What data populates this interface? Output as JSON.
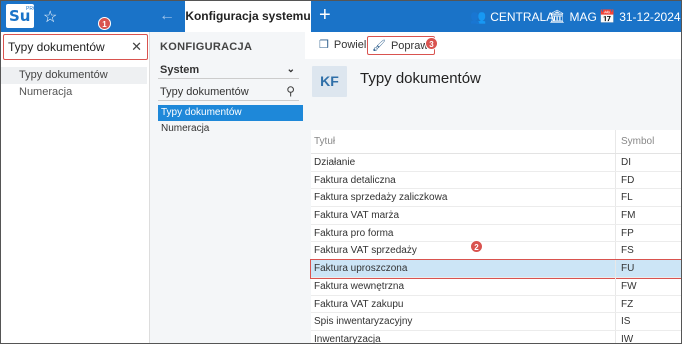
{
  "topbar": {
    "logo_main": "Su",
    "logo_pro": "PRO",
    "active_tab": "Konfiguracja systemu",
    "centrala": "CENTRALA",
    "mag": "MAG",
    "date": "31-12-2024"
  },
  "left": {
    "search_value": "Typy dokumentów",
    "items": [
      "Typy dokumentów",
      "Numeracja"
    ]
  },
  "mid": {
    "title": "KONFIGURACJA",
    "select_value": "System",
    "search_value": "Typy dokumentów",
    "items": [
      "Typy dokumentów",
      "Numeracja"
    ]
  },
  "toolbar": {
    "powiel": "Powiel",
    "popraw": "Popraw"
  },
  "main": {
    "badge": "KF",
    "title": "Typy dokumentów"
  },
  "table": {
    "headers": [
      "Tytuł",
      "Symbol"
    ],
    "rows": [
      [
        "Działanie",
        "DI"
      ],
      [
        "Faktura detaliczna",
        "FD"
      ],
      [
        "Faktura sprzedaży zaliczkowa",
        "FL"
      ],
      [
        "Faktura VAT marża",
        "FM"
      ],
      [
        "Faktura pro forma",
        "FP"
      ],
      [
        "Faktura VAT sprzedaży",
        "FS"
      ],
      [
        "Faktura uproszczona",
        "FU"
      ],
      [
        "Faktura wewnętrzna",
        "FW"
      ],
      [
        "Faktura VAT zakupu",
        "FZ"
      ],
      [
        "Spis inwentaryzacyjny",
        "IS"
      ],
      [
        "Inwentaryzacja",
        "IW"
      ]
    ]
  },
  "callouts": [
    "1",
    "2",
    "3"
  ],
  "colors": {
    "topbar": "#1a73c8",
    "selected": "#1e88d9",
    "highlight": "#cce5f6",
    "callout": "#d9534f"
  }
}
